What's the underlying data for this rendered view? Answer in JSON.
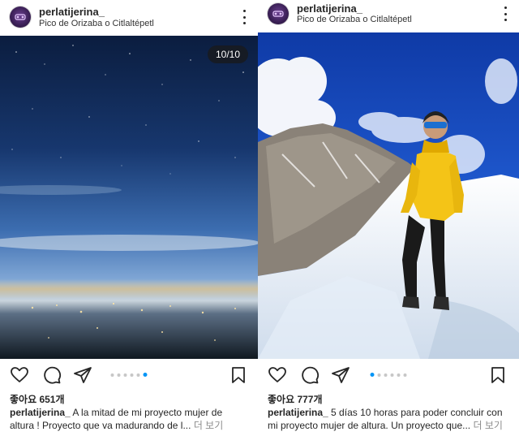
{
  "posts": [
    {
      "username": "perlatijerina_",
      "location": "Pico de Orizaba o Citlaltépetl",
      "counter": "10/10",
      "likes": "좋아요 651개",
      "caption_line1": "A la mitad de mi proyecto mujer de",
      "caption_line2": "altura ! Proyecto que va madurando de l...",
      "more": "더 보기",
      "carousel_count": 6,
      "carousel_active": 5
    },
    {
      "username": "perlatijerina_",
      "location": "Pico de Orizaba o Citlaltépetl",
      "likes": "좋아요 777개",
      "caption_line1": "5 días 10 horas para poder concluir con",
      "caption_line2": "mi proyecto mujer de altura. Un proyecto que...",
      "more": "더 보기",
      "carousel_count": 6,
      "carousel_active": 0
    }
  ],
  "icons": {
    "like": "heart-icon",
    "comment": "comment-icon",
    "share": "paper-plane-icon",
    "save": "bookmark-icon",
    "more": "more-vertical-icon"
  },
  "colors": {
    "carousel_active": "#0095f6",
    "carousel_inactive": "#c7c7c7",
    "jacket": "#f4c417",
    "sky": "#1b4fc2"
  }
}
